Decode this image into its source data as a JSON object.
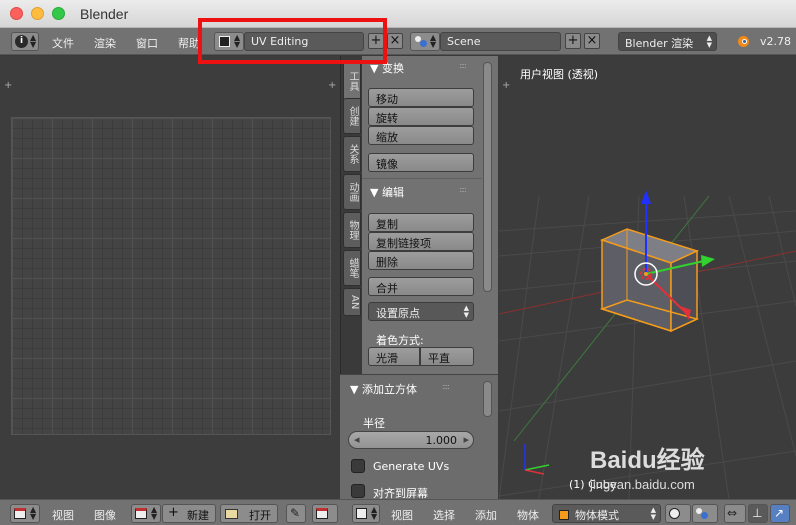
{
  "window": {
    "title": "Blender"
  },
  "menu": {
    "file": "文件",
    "render": "渲染",
    "window": "窗口",
    "help": "帮助"
  },
  "screen_layout": {
    "value": "UV Editing"
  },
  "scene": {
    "value": "Scene"
  },
  "render_engine": {
    "value": "Blender 渲染"
  },
  "version": "v2.78",
  "tool_tabs": [
    "工具",
    "创建",
    "关系",
    "动画",
    "物理",
    "蜡笔",
    "AN"
  ],
  "transform": {
    "header": "变换",
    "buttons": [
      "移动",
      "旋转",
      "缩放",
      "镜像"
    ]
  },
  "edit": {
    "header": "编辑",
    "buttons": [
      "复制",
      "复制链接项",
      "删除",
      "合并"
    ],
    "set_origin": "设置原点",
    "shading_label": "着色方式:",
    "smooth": "光滑",
    "flat": "平直"
  },
  "add_cube": {
    "header": "添加立方体",
    "radius_label": "半径",
    "radius_value": "1.000",
    "generate_uvs": "Generate UVs",
    "align_to_view": "对齐到屏幕"
  },
  "viewport": {
    "label": "用户视图 (透视)",
    "object_name": "(1) Cube"
  },
  "uv_footer": {
    "view": "视图",
    "image": "图像",
    "new": "新建",
    "open": "打开"
  },
  "view3d_footer": {
    "view": "视图",
    "select": "选择",
    "add": "添加",
    "object": "物体",
    "mode": "物体模式"
  },
  "watermark": {
    "logo": "Baidu经验",
    "url": "jingyan.baidu.com"
  },
  "colors": {
    "highlight": "#ee1111",
    "axis_x": "#e0303a",
    "axis_y": "#32d22e",
    "axis_z": "#2030ff",
    "selection": "#f39c1c"
  }
}
